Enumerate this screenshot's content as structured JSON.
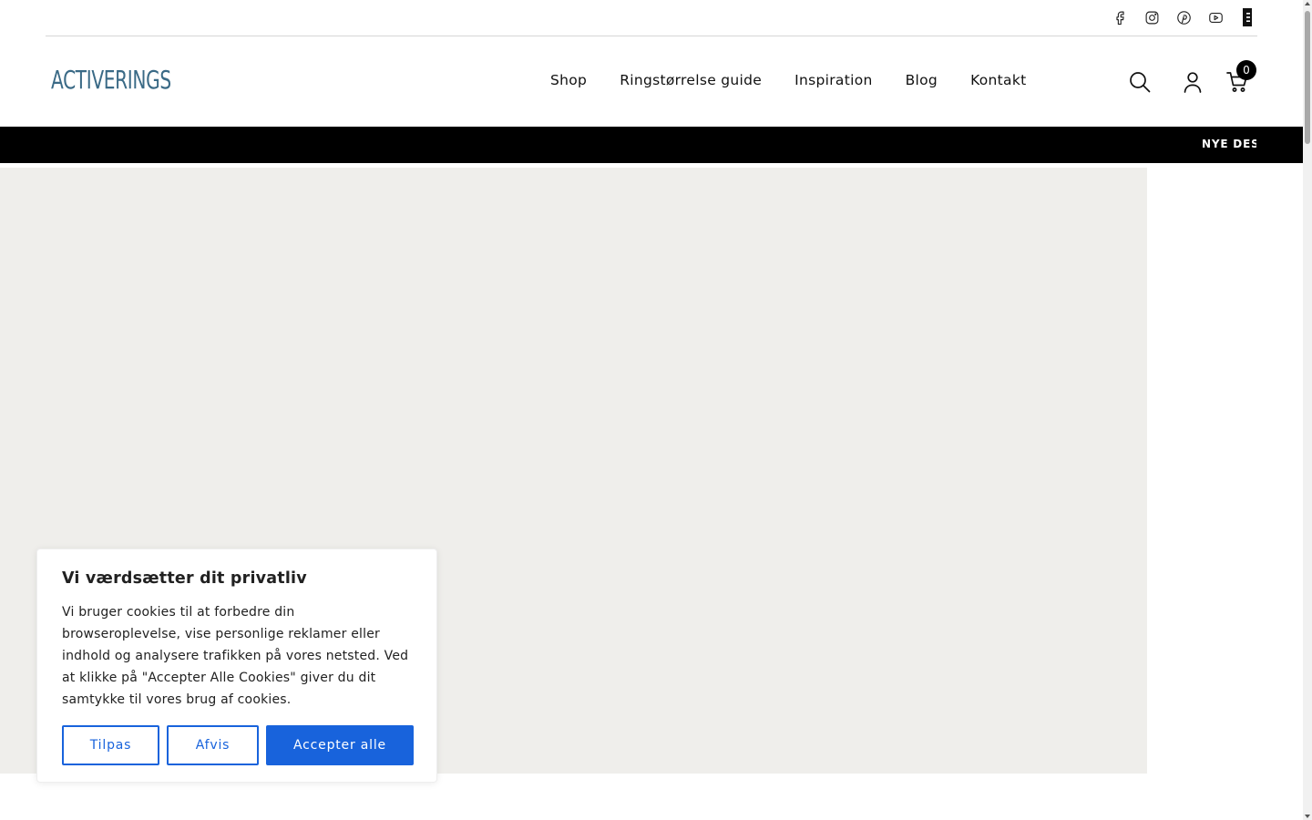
{
  "social": {
    "icons": [
      "facebook-icon",
      "instagram-icon",
      "pinterest-icon",
      "youtube-icon",
      "bookmark-icon"
    ]
  },
  "header": {
    "logo": "ACTIVERINGS",
    "nav": [
      "Shop",
      "Ringstørrelse guide",
      "Inspiration",
      "Blog",
      "Kontakt"
    ],
    "cart_count": "0",
    "icons": [
      "search-icon",
      "user-icon",
      "cart-icon"
    ]
  },
  "announcement": {
    "text": "NYE DESI"
  },
  "cookie": {
    "title": "Vi værdsætter dit privatliv",
    "body": "Vi bruger cookies til at forbedre din browseroplevelse, vise personlige reklamer eller indhold og analysere trafikken på vores netsted. Ved at klikke på \"Accepter Alle Cookies\" giver du dit samtykke til vores brug af cookies.",
    "customize_label": "Tilpas",
    "reject_label": "Afvis",
    "accept_label": "Accepter alle"
  },
  "colors": {
    "brand": "#3a6a86",
    "accent": "#1863dc",
    "hero_bg": "#efeeeb",
    "announcement_bg": "#000000"
  }
}
